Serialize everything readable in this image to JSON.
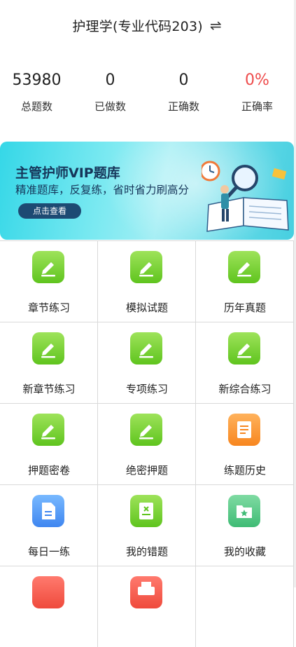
{
  "header": {
    "title": "护理学(专业代码203)",
    "switch_icon": "swap-arrows-icon"
  },
  "stats": [
    {
      "value": "53980",
      "label": "总题数"
    },
    {
      "value": "0",
      "label": "已做数"
    },
    {
      "value": "0",
      "label": "正确数"
    },
    {
      "value": "0%",
      "label": "正确率",
      "color": "#ee4b4b"
    }
  ],
  "banner": {
    "title": "主管护师VIP题库",
    "subtitle": "精准题库，反复练，省时省力刷高分",
    "button": "点击查看"
  },
  "grid": [
    {
      "label": "章节练习",
      "icon": "pencil-icon",
      "color": "#6cc72a"
    },
    {
      "label": "模拟试题",
      "icon": "pencil-icon",
      "color": "#6cc72a"
    },
    {
      "label": "历年真题",
      "icon": "pencil-icon",
      "color": "#6cc72a"
    },
    {
      "label": "新章节练习",
      "icon": "pencil-icon",
      "color": "#6cc72a"
    },
    {
      "label": "专项练习",
      "icon": "pencil-icon",
      "color": "#6cc72a"
    },
    {
      "label": "新综合练习",
      "icon": "pencil-icon",
      "color": "#6cc72a"
    },
    {
      "label": "押题密卷",
      "icon": "pencil-icon",
      "color": "#6cc72a"
    },
    {
      "label": "绝密押题",
      "icon": "pencil-icon",
      "color": "#6cc72a"
    },
    {
      "label": "练题历史",
      "icon": "scroll-icon",
      "color": "#f7861f"
    },
    {
      "label": "每日一练",
      "icon": "document-icon",
      "color": "#3f86f0"
    },
    {
      "label": "我的错题",
      "icon": "wrong-book-icon",
      "color": "#6cc72a"
    },
    {
      "label": "我的收藏",
      "icon": "star-folder-icon",
      "color": "#3fbb75"
    }
  ],
  "grid_partial": [
    {
      "icon": "red-tile-icon",
      "color": "#ef4a3c"
    },
    {
      "icon": "printer-icon",
      "color": "#ef4a3c"
    }
  ]
}
